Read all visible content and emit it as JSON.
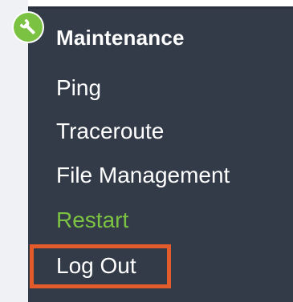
{
  "menu": {
    "heading": "Maintenance",
    "items": [
      {
        "label": "Ping"
      },
      {
        "label": "Traceroute"
      },
      {
        "label": "File Management"
      },
      {
        "label": "Restart",
        "color": "#7cc242"
      },
      {
        "label": "Log Out",
        "highlighted": true
      }
    ]
  },
  "icons": {
    "section_icon": "wrench-icon"
  },
  "colors": {
    "panel_background": "#333b48",
    "accent_green": "#7cc242",
    "highlight_orange": "#e35b2a",
    "text": "#ffffff"
  }
}
